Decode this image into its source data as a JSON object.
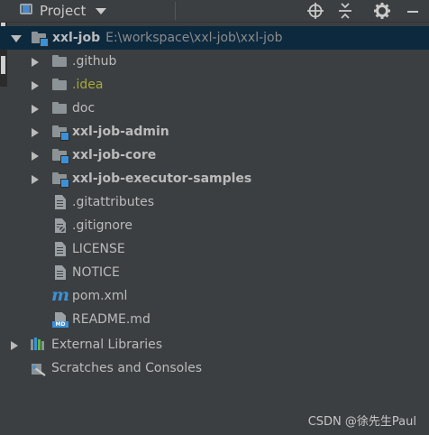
{
  "header": {
    "title": "Project"
  },
  "tree": [
    {
      "label": "xxl-job",
      "path": "E:\\workspace\\xxl-job\\xxl-job",
      "kind": "module",
      "depth": 0,
      "state": "expanded",
      "bold": true
    },
    {
      "label": ".github",
      "kind": "folder",
      "depth": 1,
      "state": "collapsed"
    },
    {
      "label": ".idea",
      "kind": "folder",
      "depth": 1,
      "state": "collapsed",
      "color": "#a7a93a"
    },
    {
      "label": "doc",
      "kind": "folder",
      "depth": 1,
      "state": "collapsed"
    },
    {
      "label": "xxl-job-admin",
      "kind": "module",
      "depth": 1,
      "state": "collapsed",
      "bold": true
    },
    {
      "label": "xxl-job-core",
      "kind": "module",
      "depth": 1,
      "state": "collapsed",
      "bold": true
    },
    {
      "label": "xxl-job-executor-samples",
      "kind": "module",
      "depth": 1,
      "state": "collapsed",
      "bold": true
    },
    {
      "label": ".gitattributes",
      "kind": "file",
      "depth": 1
    },
    {
      "label": ".gitignore",
      "kind": "file-ignore",
      "depth": 1
    },
    {
      "label": "LICENSE",
      "kind": "file",
      "depth": 1
    },
    {
      "label": "NOTICE",
      "kind": "file",
      "depth": 1
    },
    {
      "label": "pom.xml",
      "kind": "maven",
      "depth": 1
    },
    {
      "label": "README.md",
      "kind": "markdown",
      "depth": 1
    },
    {
      "label": "External Libraries",
      "kind": "libraries",
      "depth": 0,
      "state": "collapsed"
    },
    {
      "label": "Scratches and Consoles",
      "kind": "scratches",
      "depth": 0
    }
  ],
  "icons": {
    "markdown_badge": "MD",
    "maven_glyph": "m"
  },
  "watermark": "CSDN @徐先生Paul"
}
